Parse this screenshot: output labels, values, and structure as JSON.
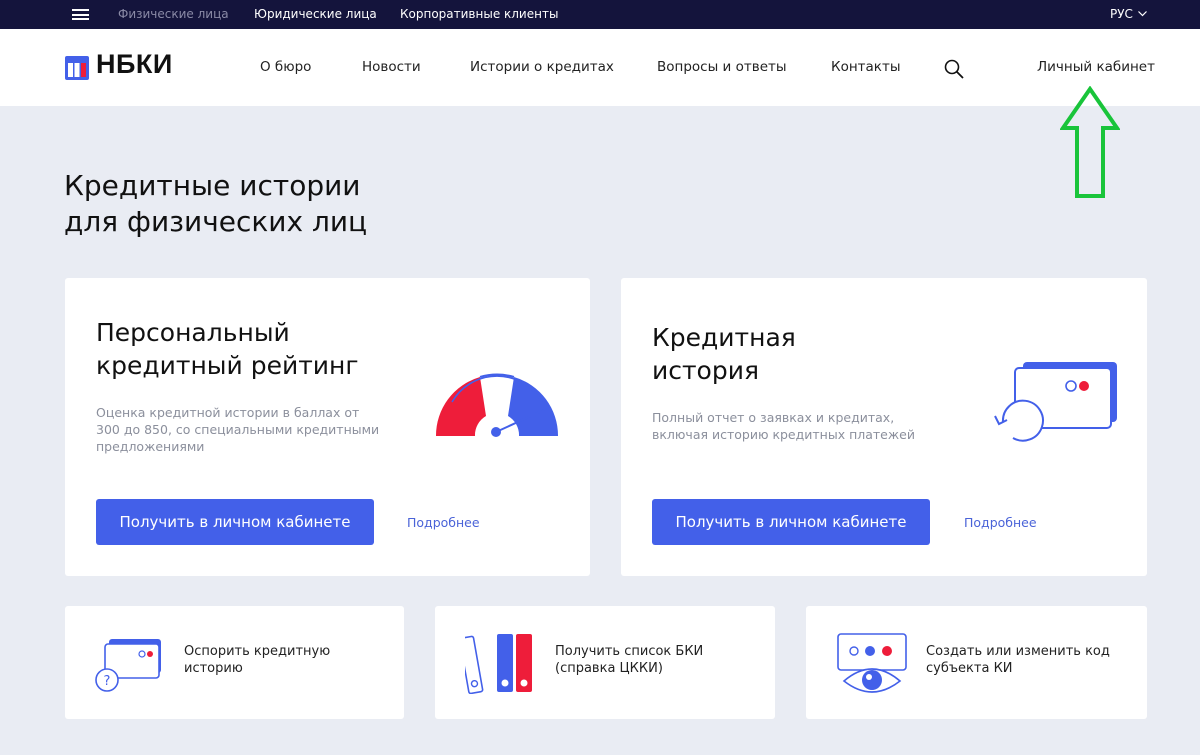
{
  "topbar": {
    "segments": [
      "Физические лица",
      "Юридические лица",
      "Корпоративные клиенты"
    ],
    "lang": "РУС"
  },
  "header": {
    "logo": "НБКИ",
    "nav": [
      "О бюро",
      "Новости",
      "Истории о кредитах",
      "Вопросы и ответы",
      "Контакты"
    ],
    "account": "Личный кабинет"
  },
  "page": {
    "title_line1": "Кредитные истории",
    "title_line2": "для физических лиц"
  },
  "cards": [
    {
      "title_line1": "Персональный",
      "title_line2": "кредитный рейтинг",
      "desc_line1": "Оценка кредитной истории в баллах от",
      "desc_line2": "300 до 850, со специальными кредитными",
      "desc_line3": "предложениями",
      "button": "Получить в личном кабинете",
      "more": "Подробнее"
    },
    {
      "title_line1": "Кредитная",
      "title_line2": "история",
      "desc_line1": "Полный отчет о заявках и кредитах,",
      "desc_line2": "включая историю кредитных платежей",
      "button": "Получить в личном кабинете",
      "more": "Подробнее"
    }
  ],
  "small_cards": [
    {
      "line1": "Оспорить кредитную",
      "line2": "историю"
    },
    {
      "line1": "Получить список БКИ",
      "line2": "(справка ЦККИ)"
    },
    {
      "line1": "Создать или изменить код",
      "line2": "субъекта КИ"
    }
  ],
  "colors": {
    "topbar_bg": "#14143c",
    "accent_blue": "#4360e9",
    "accent_red": "#ee1d3a",
    "annotation_arrow": "#19c43a"
  }
}
